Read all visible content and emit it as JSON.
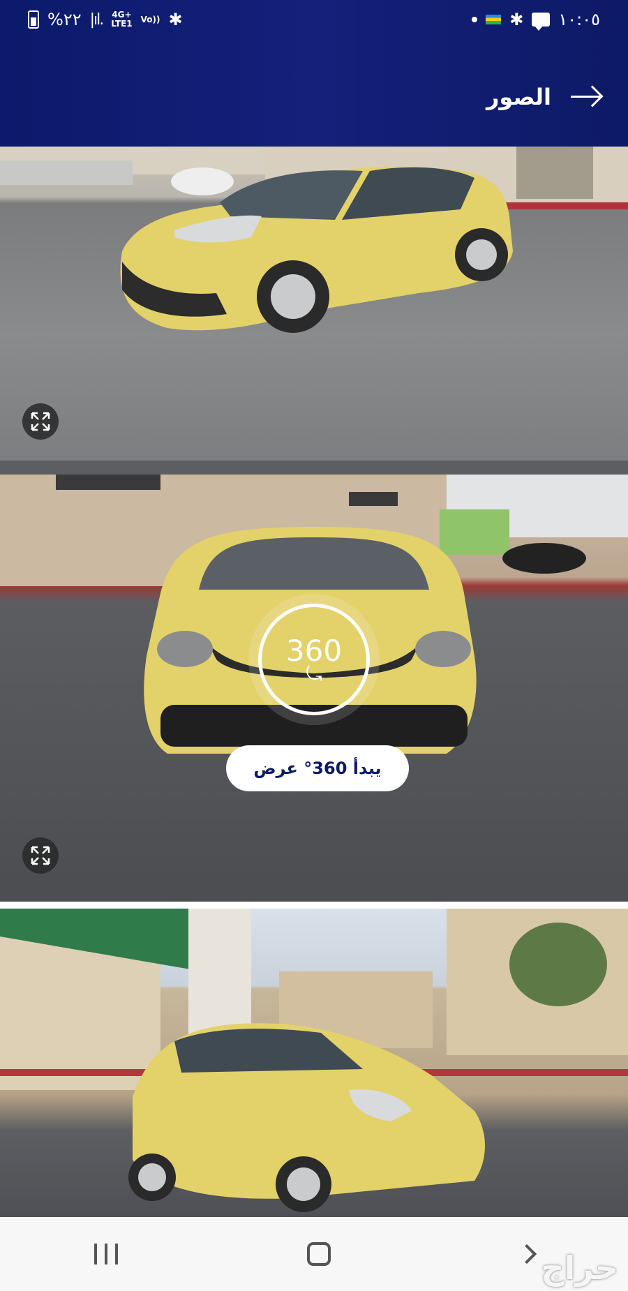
{
  "status_bar": {
    "battery": "%٢٢",
    "network_top": "4G+",
    "network_bottom": "LTE1",
    "volte": "Vo))",
    "time": "١٠:٠٥"
  },
  "header": {
    "title": "الصور",
    "back_icon": "arrow-right-icon"
  },
  "photos": [
    {
      "alt": "yellow-sedan-side-view",
      "has_expand": true
    },
    {
      "alt": "yellow-sedan-front-view",
      "has_expand": true,
      "view360": {
        "ring_label": "360",
        "button_label": "يبدأ 360° عرض"
      }
    },
    {
      "alt": "yellow-sedan-rear-side-view",
      "has_expand": false
    }
  ],
  "nav_bar": {
    "items": [
      "recents-icon",
      "home-icon",
      "back-icon"
    ]
  },
  "watermark": "حراج",
  "colors": {
    "header_bg": "#0d1a66",
    "car_yellow": "#e3d16a",
    "accent_text": "#0d1a66"
  }
}
